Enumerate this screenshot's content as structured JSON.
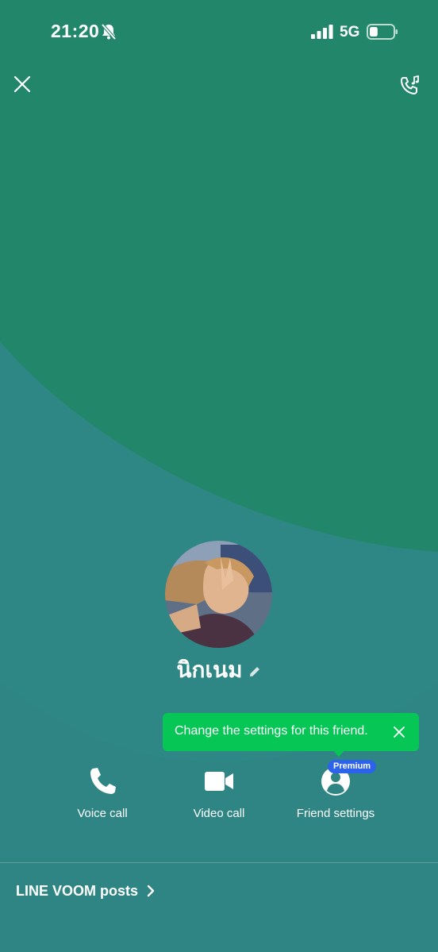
{
  "status_bar": {
    "time": "21:20",
    "network": "5G",
    "battery_level": 0.35
  },
  "header": {
    "close_icon": "close-icon",
    "ringtone_icon": "ringtone-call-icon"
  },
  "profile": {
    "name": "นิกเนม"
  },
  "tooltip": {
    "text": "Change the settings for this friend."
  },
  "actions": [
    {
      "label": "Voice call",
      "icon": "phone-icon"
    },
    {
      "label": "Video call",
      "icon": "video-camera-icon"
    },
    {
      "label": "Friend settings",
      "icon": "person-icon",
      "badge": "Premium"
    }
  ],
  "footer": {
    "voom_label": "LINE VOOM posts"
  },
  "colors": {
    "background_top": "#22876a",
    "background_bottom": "#2e8583",
    "accent_green": "#06c755",
    "premium_blue": "#2c63ea"
  }
}
